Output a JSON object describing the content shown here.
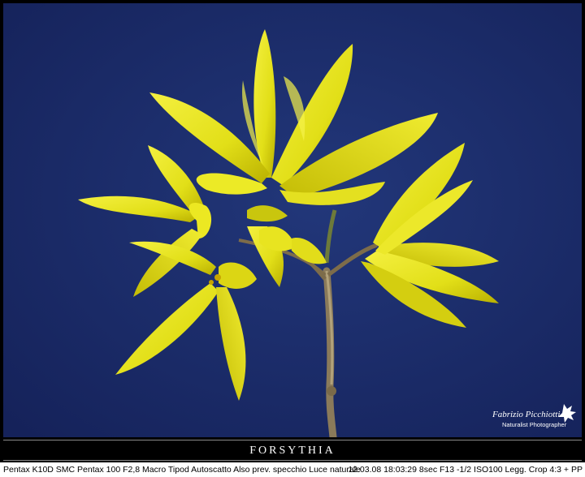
{
  "photo": {
    "subject": "yellow forsythia flowers on a branch",
    "background_color": "#1c2e6a",
    "petal_color": "#e8e820",
    "petal_shadow_color": "#b8b000",
    "stem_color": "#8a7a5a"
  },
  "watermark": {
    "signature": "Fabrizio Picchiotti",
    "subtitle": "Naturalist Photographer"
  },
  "caption": {
    "title": "Forsythia"
  },
  "exif": {
    "left": "Pentax K10D SMC Pentax 100 F2,8 Macro Tipod Autoscatto Also prev. specchio Luce naturale",
    "right": "12.03.08 18:03:29 8sec F13 -1/2 ISO100 Legg. Crop 4:3 + PP"
  }
}
